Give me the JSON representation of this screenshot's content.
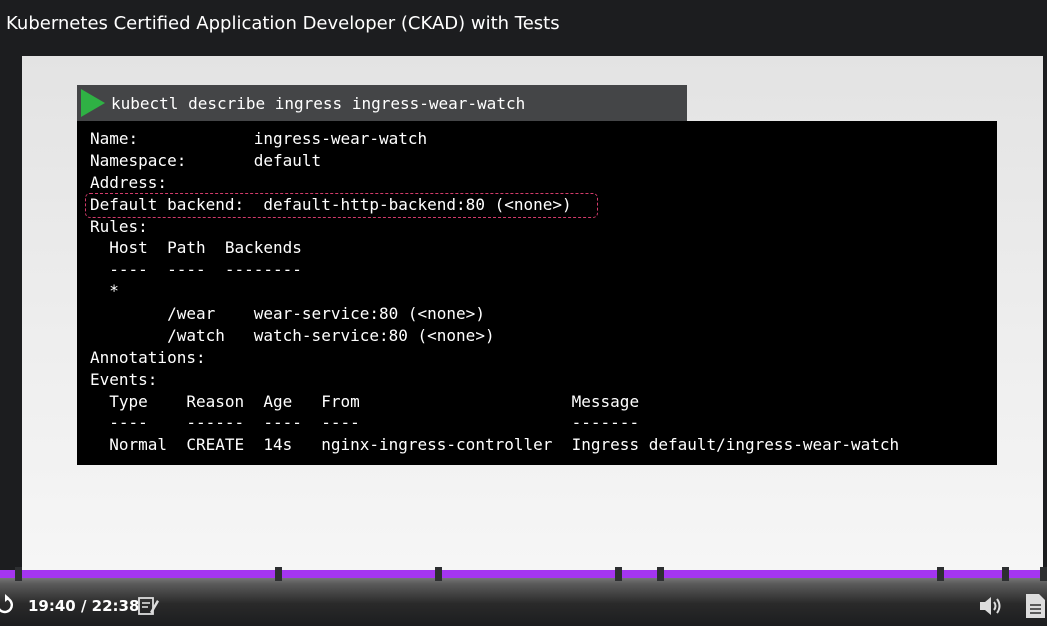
{
  "header": {
    "course_title": "Kubernetes Certified Application Developer (CKAD) with Tests"
  },
  "slide": {
    "command": "kubectl describe ingress ingress-wear-watch",
    "terminal_lines": [
      "Name:            ingress-wear-watch",
      "Namespace:       default",
      "Address:",
      "Default backend:  default-http-backend:80 (<none>)",
      "Rules:",
      "  Host  Path  Backends",
      "  ----  ----  --------",
      "  *",
      "        /wear    wear-service:80 (<none>)",
      "        /watch   watch-service:80 (<none>)",
      "Annotations:",
      "Events:",
      "  Type    Reason  Age   From                      Message",
      "  ----    ------  ----  ----                      -------",
      "  Normal  CREATE  14s   nginx-ingress-controller  Ingress default/ingress-wear-watch"
    ],
    "highlighted_line": "Default backend:  default-http-backend:80 (<none>)"
  },
  "player": {
    "time_display": "19:40 / 22:38",
    "progress_fraction": 1.0,
    "chapter_marker_count": 8,
    "icons": [
      "replay-icon",
      "notes-icon",
      "volume-icon",
      "transcript-icon"
    ]
  },
  "colors": {
    "accent": "#a435f0",
    "play": "#2fb144",
    "highlight": "#d23b6a"
  }
}
